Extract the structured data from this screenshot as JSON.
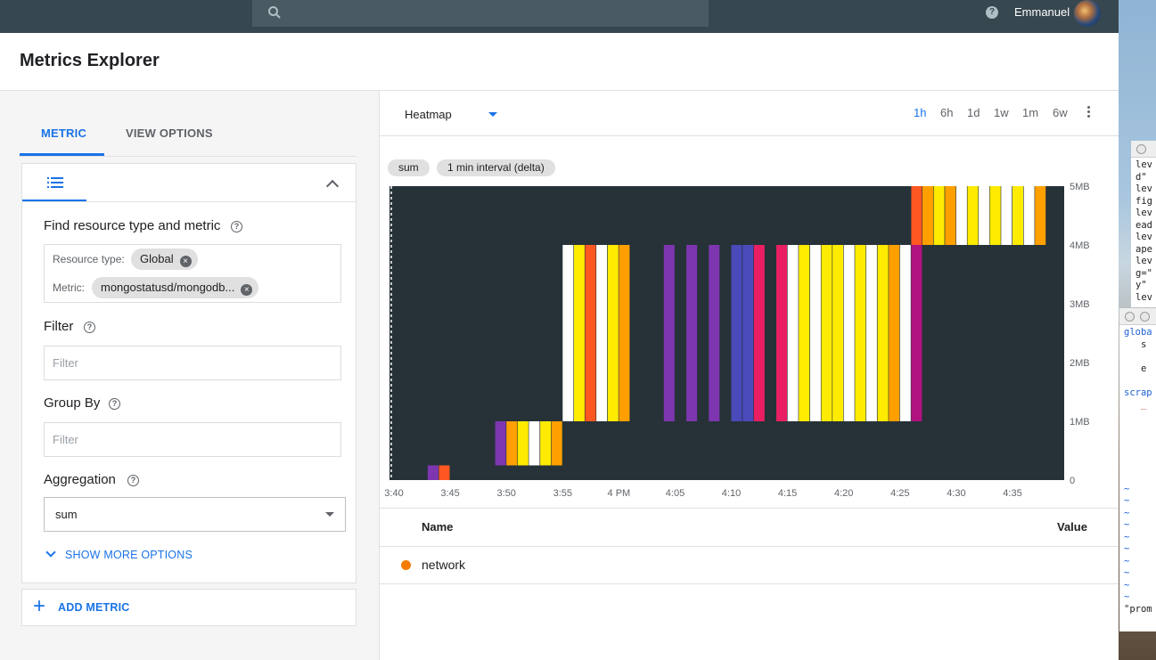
{
  "header": {
    "search_placeholder": "",
    "user_name": "Emmanuel",
    "help_label": "?"
  },
  "page": {
    "title": "Metrics Explorer"
  },
  "left_panel": {
    "tabs": [
      {
        "label": "METRIC",
        "active": true
      },
      {
        "label": "VIEW OPTIONS",
        "active": false
      }
    ],
    "find_label": "Find resource type and metric",
    "resource_type_label": "Resource type:",
    "resource_type_value": "Global",
    "metric_label": "Metric:",
    "metric_value": "mongostatusd/mongodb...",
    "filter_label": "Filter",
    "filter_placeholder": "Filter",
    "group_by_label": "Group By",
    "group_by_placeholder": "Filter",
    "aggregation_label": "Aggregation",
    "aggregation_value": "sum",
    "show_more_label": "SHOW MORE OPTIONS",
    "add_metric_label": "ADD METRIC",
    "help_label": "?"
  },
  "chart_panel": {
    "chart_type": "Heatmap",
    "time_ranges": [
      "1h",
      "6h",
      "1d",
      "1w",
      "1m",
      "6w"
    ],
    "active_time_range": "1h",
    "pills": [
      "sum",
      "1 min interval (delta)"
    ],
    "table": {
      "headers": {
        "name": "Name",
        "value": "Value"
      },
      "rows": [
        {
          "name": "network",
          "value": "",
          "color": "#f57c00"
        }
      ]
    }
  },
  "chart_data": {
    "type": "heatmap",
    "x_ticks": [
      "3:40",
      "3:45",
      "3:50",
      "3:55",
      "4 PM",
      "4:05",
      "4:10",
      "4:15",
      "4:20",
      "4:25",
      "4:30",
      "4:35"
    ],
    "y_ticks": [
      "0",
      "1MB",
      "2MB",
      "3MB",
      "4MB",
      "5MB"
    ],
    "ylim_mb": [
      0,
      5
    ],
    "background_color": "#263238",
    "cells": [
      {
        "t": "3:43",
        "ylo": 0,
        "yhi": 0.25,
        "color": "#7e36b0"
      },
      {
        "t": "3:44",
        "ylo": 0,
        "yhi": 0.25,
        "color": "#ff5722"
      },
      {
        "t": "3:49",
        "ylo": 0.25,
        "yhi": 1,
        "color": "#7e36b0"
      },
      {
        "t": "3:50",
        "ylo": 0.25,
        "yhi": 1,
        "color": "#ffa000"
      },
      {
        "t": "3:51",
        "ylo": 0.25,
        "yhi": 1,
        "color": "#ffeb00"
      },
      {
        "t": "3:52",
        "ylo": 0.25,
        "yhi": 1,
        "color": "#ffffff"
      },
      {
        "t": "3:53",
        "ylo": 0.25,
        "yhi": 1,
        "color": "#ffeb00"
      },
      {
        "t": "3:54",
        "ylo": 0.25,
        "yhi": 1,
        "color": "#ffa000"
      },
      {
        "t": "3:55",
        "ylo": 1,
        "yhi": 4,
        "color": "#ffffff"
      },
      {
        "t": "3:56",
        "ylo": 1,
        "yhi": 4,
        "color": "#ffeb00"
      },
      {
        "t": "3:57",
        "ylo": 1,
        "yhi": 4,
        "color": "#ff5722"
      },
      {
        "t": "3:58",
        "ylo": 1,
        "yhi": 4,
        "color": "#ffffff"
      },
      {
        "t": "3:59",
        "ylo": 1,
        "yhi": 4,
        "color": "#ffeb00"
      },
      {
        "t": "4:00",
        "ylo": 1,
        "yhi": 4,
        "color": "#ffa000"
      },
      {
        "t": "4:04",
        "ylo": 1,
        "yhi": 4,
        "color": "#7e36b0"
      },
      {
        "t": "4:06",
        "ylo": 1,
        "yhi": 4,
        "color": "#7e36b0"
      },
      {
        "t": "4:08",
        "ylo": 1,
        "yhi": 4,
        "color": "#7e36b0"
      },
      {
        "t": "4:10",
        "ylo": 1,
        "yhi": 4,
        "color": "#4a4aba"
      },
      {
        "t": "4:11",
        "ylo": 1,
        "yhi": 4,
        "color": "#4a4aba"
      },
      {
        "t": "4:12",
        "ylo": 1,
        "yhi": 4,
        "color": "#e91e63"
      },
      {
        "t": "4:14",
        "ylo": 1,
        "yhi": 4,
        "color": "#e91e63"
      },
      {
        "t": "4:15",
        "ylo": 1,
        "yhi": 4,
        "color": "#ffffff"
      },
      {
        "t": "4:16",
        "ylo": 1,
        "yhi": 4,
        "color": "#ffeb00"
      },
      {
        "t": "4:17",
        "ylo": 1,
        "yhi": 4,
        "color": "#ffffff"
      },
      {
        "t": "4:18",
        "ylo": 1,
        "yhi": 4,
        "color": "#ffeb00"
      },
      {
        "t": "4:19",
        "ylo": 1,
        "yhi": 4,
        "color": "#ffeb00"
      },
      {
        "t": "4:20",
        "ylo": 1,
        "yhi": 4,
        "color": "#ffffff"
      },
      {
        "t": "4:21",
        "ylo": 1,
        "yhi": 4,
        "color": "#ffeb00"
      },
      {
        "t": "4:22",
        "ylo": 1,
        "yhi": 4,
        "color": "#ffffff"
      },
      {
        "t": "4:23",
        "ylo": 1,
        "yhi": 4,
        "color": "#ffeb00"
      },
      {
        "t": "4:24",
        "ylo": 1,
        "yhi": 4,
        "color": "#ffa000"
      },
      {
        "t": "4:25",
        "ylo": 1,
        "yhi": 4,
        "color": "#ffffff"
      },
      {
        "t": "4:26",
        "ylo": 1,
        "yhi": 4,
        "color": "#b0127f"
      },
      {
        "t": "4:26",
        "ylo": 4,
        "yhi": 5,
        "color": "#ff5722"
      },
      {
        "t": "4:27",
        "ylo": 4,
        "yhi": 5,
        "color": "#ffa000"
      },
      {
        "t": "4:28",
        "ylo": 4,
        "yhi": 5,
        "color": "#ffeb00"
      },
      {
        "t": "4:29",
        "ylo": 4,
        "yhi": 5,
        "color": "#ffa000"
      },
      {
        "t": "4:30",
        "ylo": 4,
        "yhi": 5,
        "color": "#ffffff"
      },
      {
        "t": "4:31",
        "ylo": 4,
        "yhi": 5,
        "color": "#ffeb00"
      },
      {
        "t": "4:32",
        "ylo": 4,
        "yhi": 5,
        "color": "#ffffff"
      },
      {
        "t": "4:33",
        "ylo": 4,
        "yhi": 5,
        "color": "#ffeb00"
      },
      {
        "t": "4:34",
        "ylo": 4,
        "yhi": 5,
        "color": "#ffffff"
      },
      {
        "t": "4:35",
        "ylo": 4,
        "yhi": 5,
        "color": "#ffeb00"
      },
      {
        "t": "4:36",
        "ylo": 4,
        "yhi": 5,
        "color": "#ffffff"
      },
      {
        "t": "4:37",
        "ylo": 4,
        "yhi": 5,
        "color": "#ffa000"
      }
    ]
  },
  "background_windows": {
    "terminal_top_lines": [
      "lev",
      "d\"",
      "lev",
      "fig",
      "lev",
      "ead",
      "lev",
      "ape",
      "lev",
      "g=\"",
      "y\"",
      "lev"
    ],
    "terminal_bottom_lines": [
      "globa",
      "   s",
      "",
      "   e",
      "",
      "scrap",
      "   _",
      "",
      "",
      "",
      "",
      "",
      "",
      "~",
      "~",
      "~",
      "~",
      "~",
      "~",
      "~",
      "~",
      "~",
      "~",
      "\"prom"
    ]
  }
}
